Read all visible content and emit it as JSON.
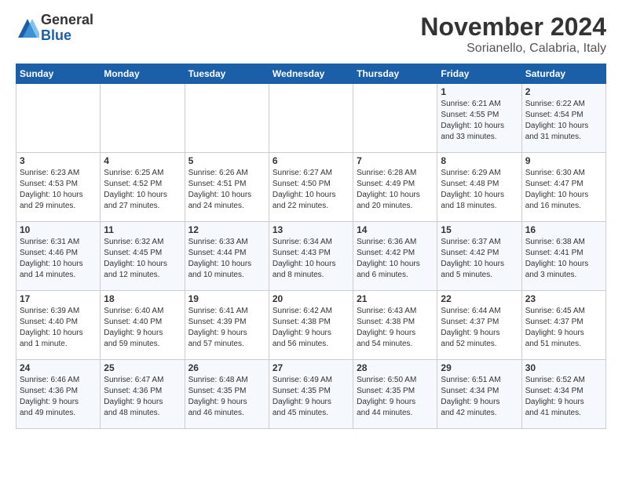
{
  "logo": {
    "general": "General",
    "blue": "Blue"
  },
  "header": {
    "month": "November 2024",
    "location": "Sorianello, Calabria, Italy"
  },
  "weekdays": [
    "Sunday",
    "Monday",
    "Tuesday",
    "Wednesday",
    "Thursday",
    "Friday",
    "Saturday"
  ],
  "weeks": [
    [
      {
        "day": "",
        "info": ""
      },
      {
        "day": "",
        "info": ""
      },
      {
        "day": "",
        "info": ""
      },
      {
        "day": "",
        "info": ""
      },
      {
        "day": "",
        "info": ""
      },
      {
        "day": "1",
        "info": "Sunrise: 6:21 AM\nSunset: 4:55 PM\nDaylight: 10 hours\nand 33 minutes."
      },
      {
        "day": "2",
        "info": "Sunrise: 6:22 AM\nSunset: 4:54 PM\nDaylight: 10 hours\nand 31 minutes."
      }
    ],
    [
      {
        "day": "3",
        "info": "Sunrise: 6:23 AM\nSunset: 4:53 PM\nDaylight: 10 hours\nand 29 minutes."
      },
      {
        "day": "4",
        "info": "Sunrise: 6:25 AM\nSunset: 4:52 PM\nDaylight: 10 hours\nand 27 minutes."
      },
      {
        "day": "5",
        "info": "Sunrise: 6:26 AM\nSunset: 4:51 PM\nDaylight: 10 hours\nand 24 minutes."
      },
      {
        "day": "6",
        "info": "Sunrise: 6:27 AM\nSunset: 4:50 PM\nDaylight: 10 hours\nand 22 minutes."
      },
      {
        "day": "7",
        "info": "Sunrise: 6:28 AM\nSunset: 4:49 PM\nDaylight: 10 hours\nand 20 minutes."
      },
      {
        "day": "8",
        "info": "Sunrise: 6:29 AM\nSunset: 4:48 PM\nDaylight: 10 hours\nand 18 minutes."
      },
      {
        "day": "9",
        "info": "Sunrise: 6:30 AM\nSunset: 4:47 PM\nDaylight: 10 hours\nand 16 minutes."
      }
    ],
    [
      {
        "day": "10",
        "info": "Sunrise: 6:31 AM\nSunset: 4:46 PM\nDaylight: 10 hours\nand 14 minutes."
      },
      {
        "day": "11",
        "info": "Sunrise: 6:32 AM\nSunset: 4:45 PM\nDaylight: 10 hours\nand 12 minutes."
      },
      {
        "day": "12",
        "info": "Sunrise: 6:33 AM\nSunset: 4:44 PM\nDaylight: 10 hours\nand 10 minutes."
      },
      {
        "day": "13",
        "info": "Sunrise: 6:34 AM\nSunset: 4:43 PM\nDaylight: 10 hours\nand 8 minutes."
      },
      {
        "day": "14",
        "info": "Sunrise: 6:36 AM\nSunset: 4:42 PM\nDaylight: 10 hours\nand 6 minutes."
      },
      {
        "day": "15",
        "info": "Sunrise: 6:37 AM\nSunset: 4:42 PM\nDaylight: 10 hours\nand 5 minutes."
      },
      {
        "day": "16",
        "info": "Sunrise: 6:38 AM\nSunset: 4:41 PM\nDaylight: 10 hours\nand 3 minutes."
      }
    ],
    [
      {
        "day": "17",
        "info": "Sunrise: 6:39 AM\nSunset: 4:40 PM\nDaylight: 10 hours\nand 1 minute."
      },
      {
        "day": "18",
        "info": "Sunrise: 6:40 AM\nSunset: 4:40 PM\nDaylight: 9 hours\nand 59 minutes."
      },
      {
        "day": "19",
        "info": "Sunrise: 6:41 AM\nSunset: 4:39 PM\nDaylight: 9 hours\nand 57 minutes."
      },
      {
        "day": "20",
        "info": "Sunrise: 6:42 AM\nSunset: 4:38 PM\nDaylight: 9 hours\nand 56 minutes."
      },
      {
        "day": "21",
        "info": "Sunrise: 6:43 AM\nSunset: 4:38 PM\nDaylight: 9 hours\nand 54 minutes."
      },
      {
        "day": "22",
        "info": "Sunrise: 6:44 AM\nSunset: 4:37 PM\nDaylight: 9 hours\nand 52 minutes."
      },
      {
        "day": "23",
        "info": "Sunrise: 6:45 AM\nSunset: 4:37 PM\nDaylight: 9 hours\nand 51 minutes."
      }
    ],
    [
      {
        "day": "24",
        "info": "Sunrise: 6:46 AM\nSunset: 4:36 PM\nDaylight: 9 hours\nand 49 minutes."
      },
      {
        "day": "25",
        "info": "Sunrise: 6:47 AM\nSunset: 4:36 PM\nDaylight: 9 hours\nand 48 minutes."
      },
      {
        "day": "26",
        "info": "Sunrise: 6:48 AM\nSunset: 4:35 PM\nDaylight: 9 hours\nand 46 minutes."
      },
      {
        "day": "27",
        "info": "Sunrise: 6:49 AM\nSunset: 4:35 PM\nDaylight: 9 hours\nand 45 minutes."
      },
      {
        "day": "28",
        "info": "Sunrise: 6:50 AM\nSunset: 4:35 PM\nDaylight: 9 hours\nand 44 minutes."
      },
      {
        "day": "29",
        "info": "Sunrise: 6:51 AM\nSunset: 4:34 PM\nDaylight: 9 hours\nand 42 minutes."
      },
      {
        "day": "30",
        "info": "Sunrise: 6:52 AM\nSunset: 4:34 PM\nDaylight: 9 hours\nand 41 minutes."
      }
    ]
  ]
}
